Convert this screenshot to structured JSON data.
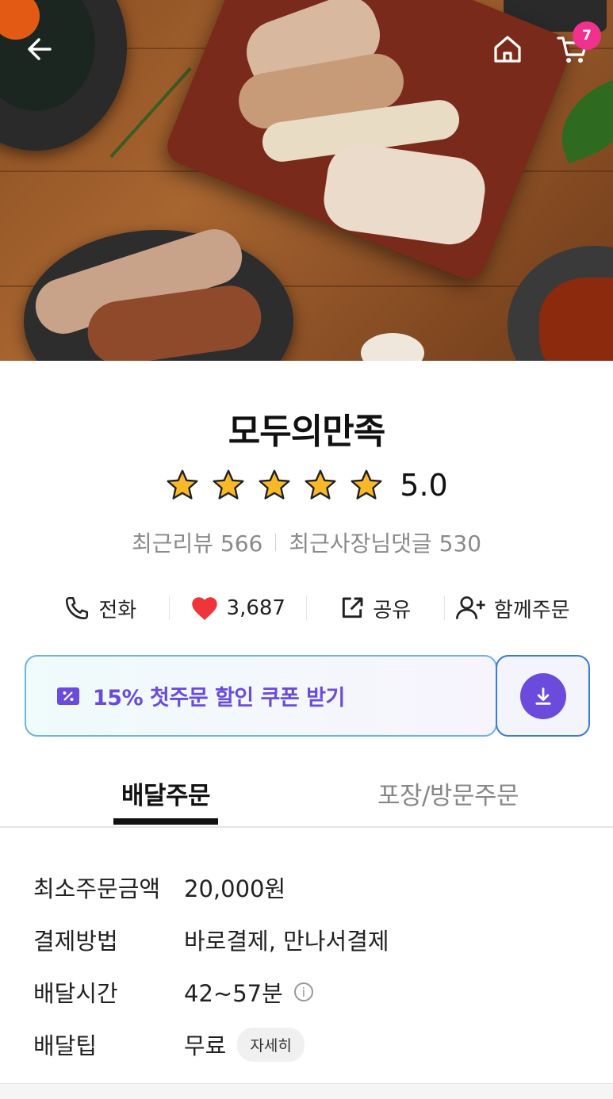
{
  "header": {
    "cart_count": "7"
  },
  "store": {
    "name": "모두의만족",
    "rating": "5.0",
    "stars": 5,
    "recent_reviews_label": "최근리뷰 566",
    "owner_replies_label": "최근사장님댓글 530"
  },
  "actions": {
    "call": "전화",
    "likes": "3,687",
    "share": "공유",
    "group_order": "함께주문"
  },
  "coupon": {
    "text": "15% 첫주문 할인 쿠폰 받기"
  },
  "tabs": {
    "delivery": "배달주문",
    "pickup": "포장/방문주문"
  },
  "info": {
    "min_order_label": "최소주문금액",
    "min_order_value": "20,000원",
    "payment_label": "결제방법",
    "payment_value": "바로결제, 만나서결제",
    "time_label": "배달시간",
    "time_value": "42~57분",
    "tip_label": "배달팁",
    "tip_value": "무료",
    "tip_detail": "자세히"
  },
  "colors": {
    "accent": "#6a4bdc",
    "badge": "#f0318e",
    "heart": "#f0343c"
  }
}
